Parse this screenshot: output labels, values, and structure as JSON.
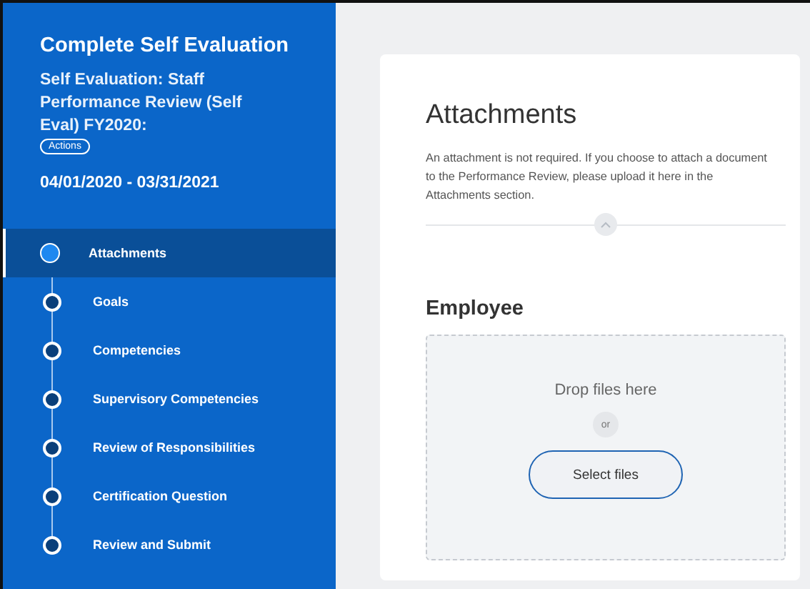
{
  "sidebar": {
    "title": "Complete Self Evaluation",
    "subtitle": "Self Evaluation: Staff Performance Review (Self Eval) FY2020:",
    "actions_button": "Actions",
    "date_range": "04/01/2020 - 03/31/2021",
    "steps": [
      {
        "label": "Attachments",
        "selected": true
      },
      {
        "label": "Goals",
        "selected": false
      },
      {
        "label": "Competencies",
        "selected": false
      },
      {
        "label": "Supervisory Competencies",
        "selected": false
      },
      {
        "label": "Review of Responsibilities",
        "selected": false
      },
      {
        "label": "Certification Question",
        "selected": false
      },
      {
        "label": "Review and Submit",
        "selected": false
      }
    ]
  },
  "main": {
    "heading": "Attachments",
    "description": "An attachment is not required.  If you choose to attach a document to the Performance Review, please upload it here in the Attachments section.",
    "section": "Employee",
    "drop_text": "Drop files here",
    "or_text": "or",
    "select_button": "Select files"
  }
}
